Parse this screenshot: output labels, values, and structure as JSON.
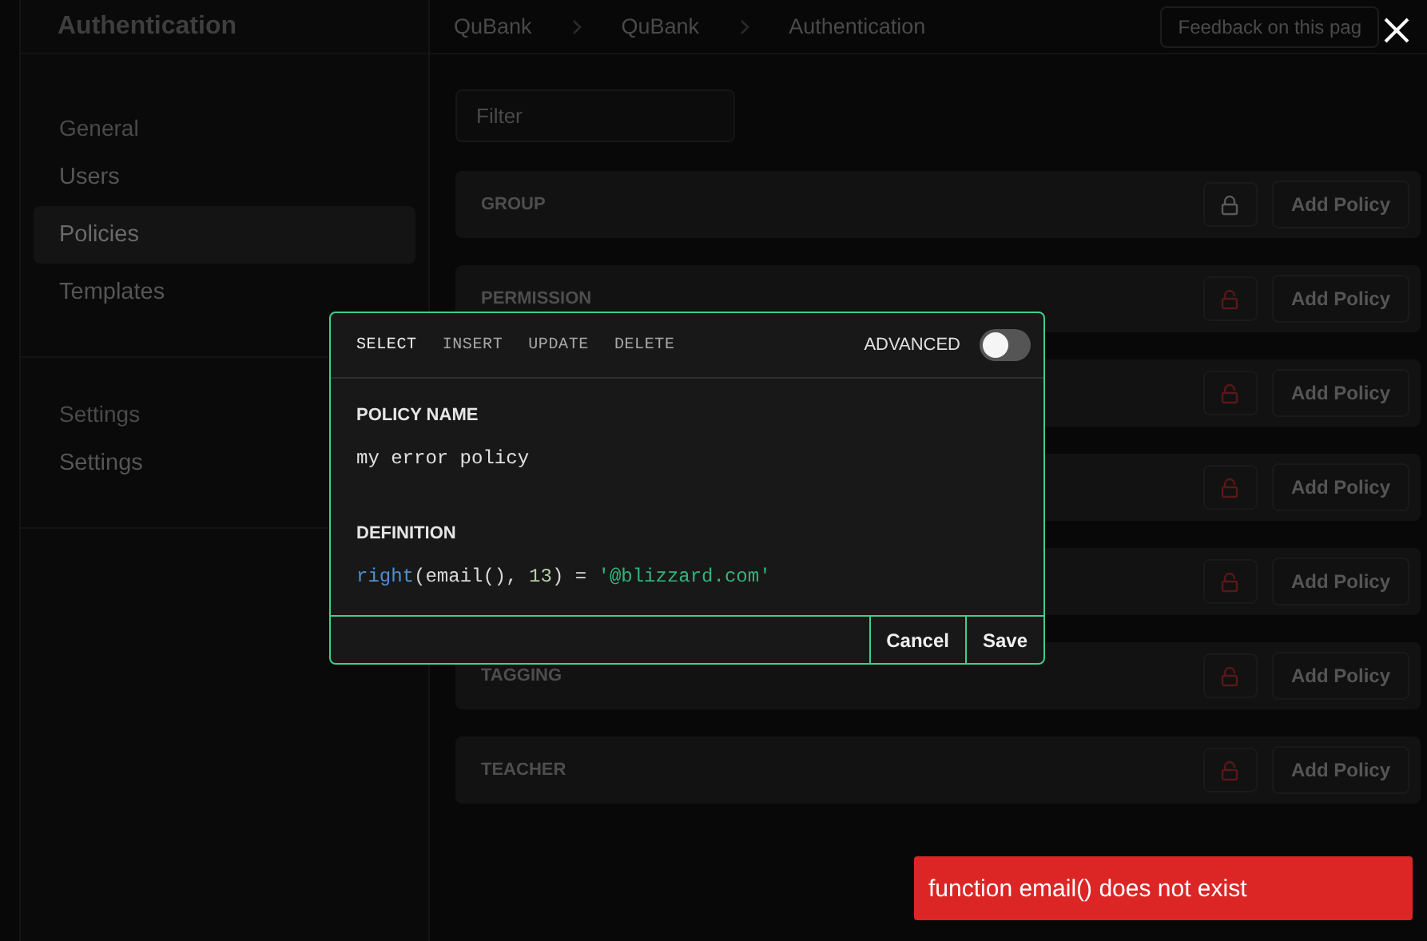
{
  "sidebar": {
    "title": "Authentication",
    "sections": [
      {
        "heading": "General",
        "items": [
          {
            "label": "Users",
            "selected": false
          },
          {
            "label": "Policies",
            "selected": true
          },
          {
            "label": "Templates",
            "selected": false
          }
        ]
      },
      {
        "heading": "Settings",
        "items": [
          {
            "label": "Settings",
            "selected": false
          }
        ]
      }
    ]
  },
  "breadcrumbs": [
    "QuBank",
    "QuBank",
    "Authentication"
  ],
  "feedback_button": "Feedback on this pag",
  "filter": {
    "placeholder": "Filter"
  },
  "tables": [
    {
      "label": "GROUP",
      "locked": true,
      "button": "Add Policy"
    },
    {
      "label": "PERMISSION",
      "locked": false,
      "button": "Add Policy"
    },
    {
      "locked": false,
      "button": "Add Policy"
    },
    {
      "locked": false,
      "button": "Add Policy"
    },
    {
      "locked": false,
      "button": "Add Policy"
    },
    {
      "label": "TAGGING",
      "locked": false,
      "button": "Add Policy"
    },
    {
      "label": "TEACHER",
      "locked": false,
      "button": "Add Policy"
    }
  ],
  "dialog": {
    "tabs": [
      {
        "label": "SELECT",
        "selected": true
      },
      {
        "label": "INSERT",
        "selected": false
      },
      {
        "label": "UPDATE",
        "selected": false
      },
      {
        "label": "DELETE",
        "selected": false
      }
    ],
    "advanced": {
      "label": "ADVANCED",
      "on": false
    },
    "policy_name_label": "POLICY NAME",
    "policy_name": "my error policy",
    "definition_label": "DEFINITION",
    "definition": [
      {
        "kind": "function",
        "text": "right"
      },
      {
        "kind": "plain",
        "text": "(email(), "
      },
      {
        "kind": "number",
        "text": "13"
      },
      {
        "kind": "plain",
        "text": ") = "
      },
      {
        "kind": "string",
        "text": "'@blizzard.com'"
      }
    ],
    "buttons": [
      "Cancel",
      "Save"
    ]
  },
  "toast": "function email() does not exist"
}
